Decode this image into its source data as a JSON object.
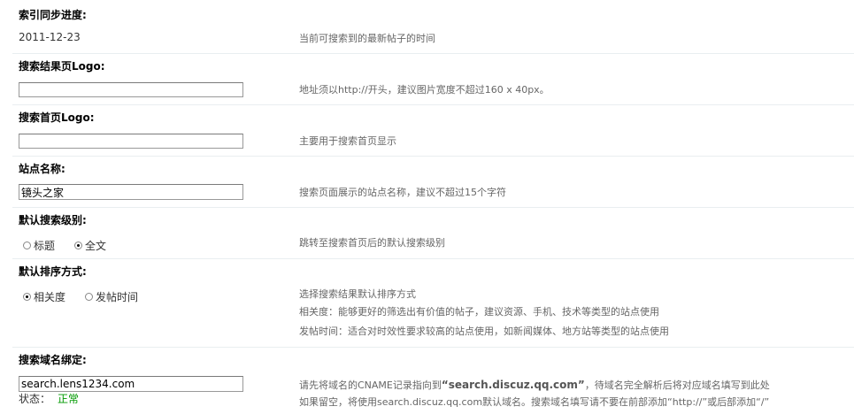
{
  "sections": {
    "sync": {
      "title": "索引同步进度:",
      "value": "2011-12-23",
      "tip": "当前可搜索到的最新帖子的时间"
    },
    "result_logo": {
      "title": "搜索结果页Logo:",
      "value": "",
      "tip": "地址须以http://开头，建议图片宽度不超过160 x 40px。"
    },
    "home_logo": {
      "title": "搜索首页Logo:",
      "value": "",
      "tip": "主要用于搜索首页显示"
    },
    "site_name": {
      "title": "站点名称:",
      "value": "镜头之家",
      "tip": "搜索页面展示的站点名称，建议不超过15个字符"
    },
    "level": {
      "title": "默认搜索级别:",
      "options": [
        "标题",
        "全文"
      ],
      "selected": "全文",
      "tip": "跳转至搜索首页后的默认搜索级别"
    },
    "sort": {
      "title": "默认排序方式:",
      "options": [
        "相关度",
        "发帖时间"
      ],
      "selected": "相关度",
      "tip_lines": [
        "选择搜索结果默认排序方式",
        "相关度：能够更好的筛选出有价值的帖子，建议资源、手机、技术等类型的站点使用",
        "发帖时间：适合对时效性要求较高的站点使用，如新闻媒体、地方站等类型的站点使用"
      ]
    },
    "domain": {
      "title": "搜索域名绑定:",
      "value": "search.lens1234.com",
      "status_label": "状态：",
      "status_value": "正常",
      "tip_line1_a": "请先将域名的CNAME记录指向到",
      "tip_line1_url": "“search.discuz.qq.com”",
      "tip_line1_b": "，待域名完全解析后将对应域名填写到此处",
      "tip_line2": "如果留空，将使用search.discuz.qq.com默认域名。搜索域名填写请不要在前部添加“http://”或后部添加“/”"
    }
  },
  "colors": {
    "status_ok": "#009900",
    "separator": "#e9eef0"
  }
}
